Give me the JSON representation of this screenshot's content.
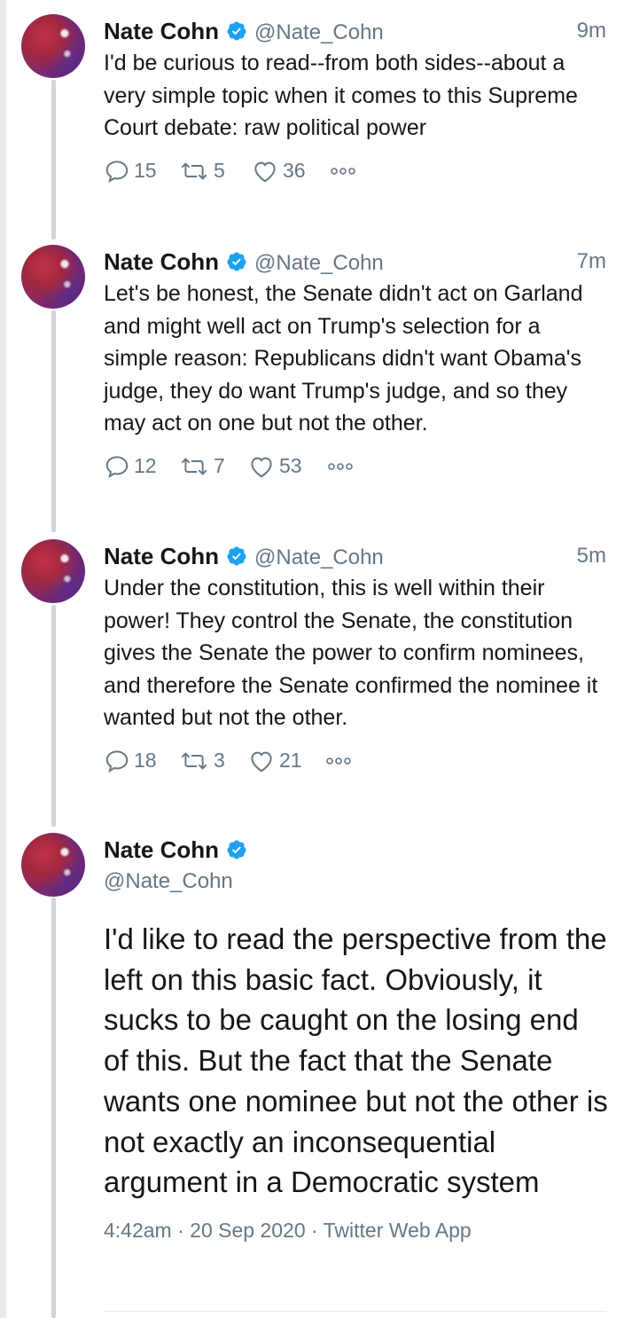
{
  "colors": {
    "text": "#14171a",
    "secondary": "#657786",
    "verified": "#1da1f2",
    "thread_line": "#ccd6dd"
  },
  "thread": [
    {
      "name": "Nate Cohn",
      "handle": "@Nate_Cohn",
      "time": "9m",
      "text": "I'd be curious to read--from both sides--about a very simple topic when it comes to this Supreme Court debate:  raw political power",
      "replies": "15",
      "retweets": "5",
      "likes": "36",
      "icons": [
        "reply-icon",
        "retweet-icon",
        "like-icon",
        "more-icon"
      ]
    },
    {
      "name": "Nate Cohn",
      "handle": "@Nate_Cohn",
      "time": "7m",
      "text": "Let's be honest, the Senate didn't act on Garland and might well act on Trump's selection for a simple reason: Republicans didn't want Obama's judge, they do want Trump's judge, and so they may act on one but not the other.",
      "replies": "12",
      "retweets": "7",
      "likes": "53"
    },
    {
      "name": "Nate Cohn",
      "handle": "@Nate_Cohn",
      "time": "5m",
      "text": "Under the constitution, this is well within their power! They control the Senate, the constitution gives the Senate the power to confirm nominees, and therefore the Senate confirmed the nominee it wanted but not the other.",
      "replies": "18",
      "retweets": "3",
      "likes": "21"
    }
  ],
  "main_tweet": {
    "name": "Nate Cohn",
    "handle": "@Nate_Cohn",
    "text": "I'd like to read the perspective from the left on this basic fact. Obviously, it sucks to be caught on the losing end of this. But the fact that the Senate wants one nominee but not the other is not exactly an inconsequential argument in a Democratic system",
    "time": "4:42am",
    "date": "20 Sep 2020",
    "source": "Twitter Web App",
    "separator": " · "
  }
}
